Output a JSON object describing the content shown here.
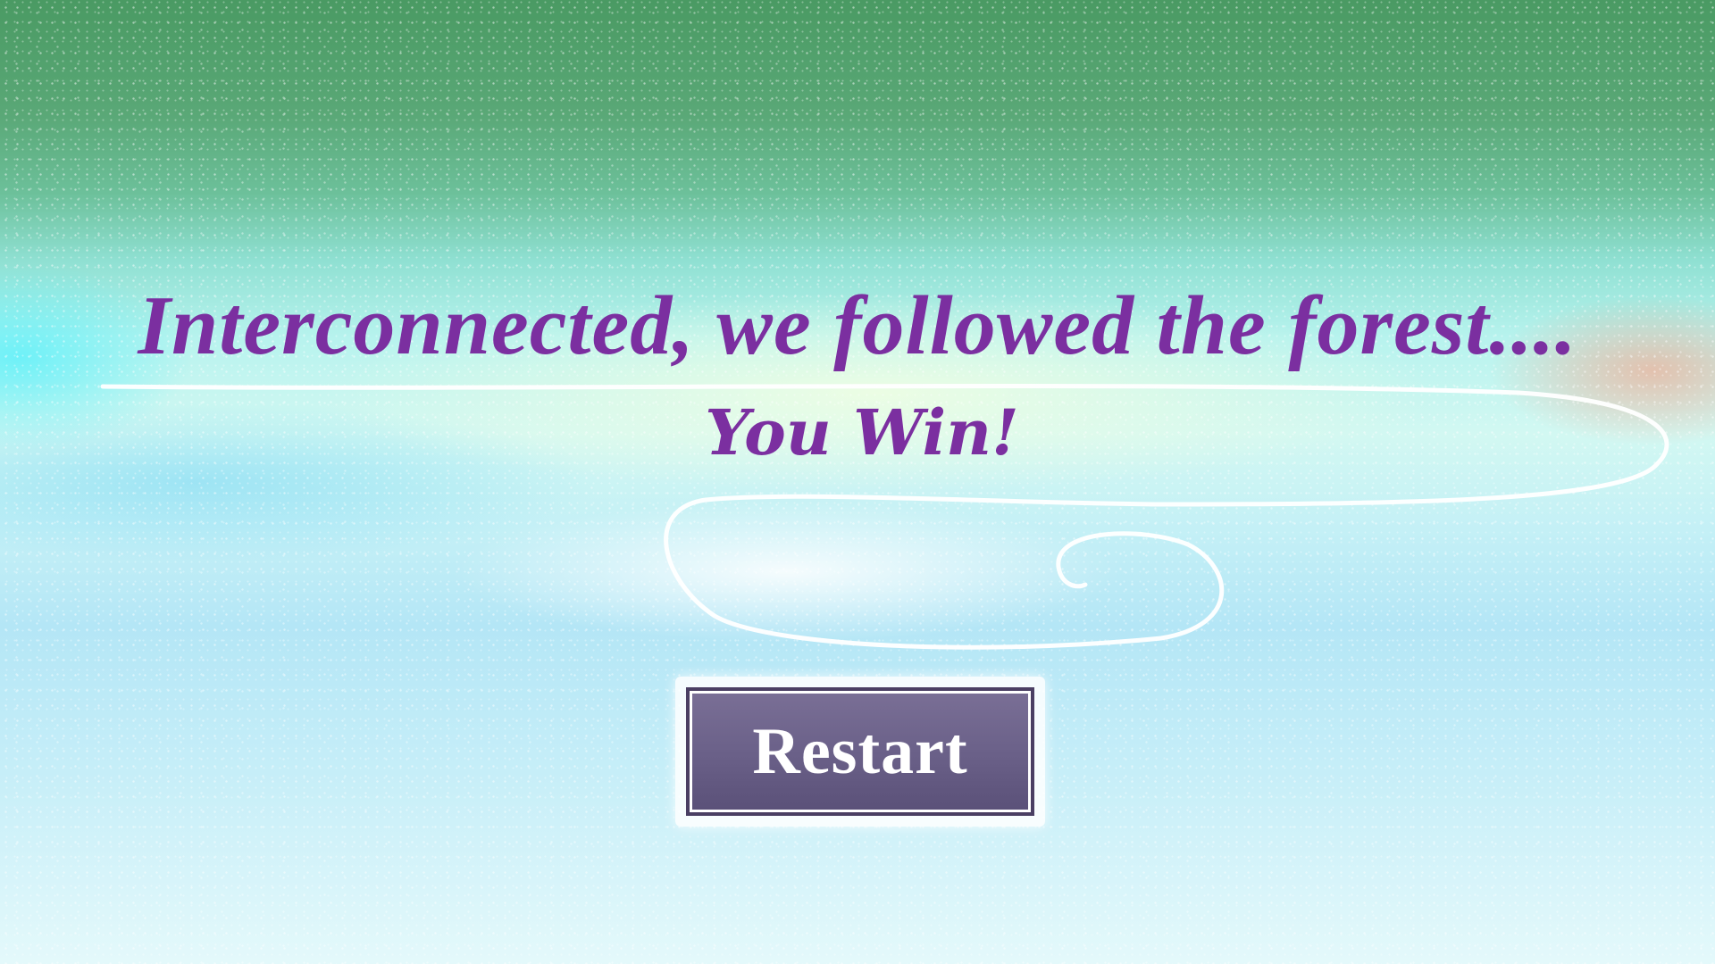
{
  "screen": {
    "headline": "Interconnected, we followed the forest....",
    "result": "You Win!"
  },
  "actions": {
    "restart_label": "Restart"
  },
  "colors": {
    "text_accent": "#7b2fa0",
    "button_fill": "#6b6189",
    "button_border": "#4a3f63",
    "sky_top": "#4a9a63",
    "sky_bottom": "#e4f9fb"
  }
}
